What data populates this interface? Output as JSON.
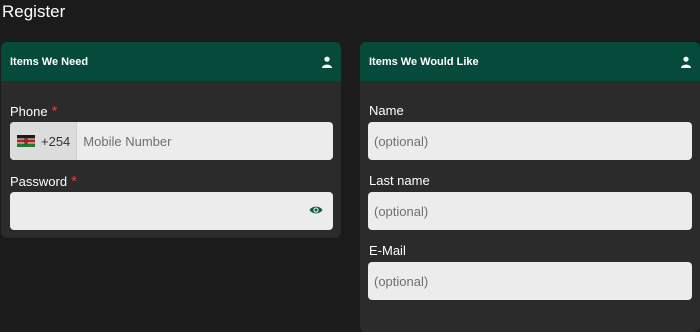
{
  "page": {
    "title": "Register"
  },
  "left_card": {
    "title": "Items We Need",
    "phone": {
      "label": "Phone",
      "required_mark": "*",
      "country_code": "+254",
      "placeholder": "Mobile Number",
      "flag_icon": "kenya-flag-icon"
    },
    "password": {
      "label": "Password",
      "required_mark": "*",
      "value": "",
      "toggle_icon": "eye-icon"
    }
  },
  "right_card": {
    "title": "Items We Would Like",
    "name": {
      "label": "Name",
      "placeholder": "(optional)"
    },
    "last_name": {
      "label": "Last name",
      "placeholder": "(optional)"
    },
    "email": {
      "label": "E-Mail",
      "placeholder": "(optional)"
    }
  },
  "colors": {
    "background": "#1b1b1b",
    "card": "#2b2b2b",
    "header": "#064a3b",
    "input": "#ececec",
    "required": "#e63d3d",
    "eye_icon": "#0b5d46"
  }
}
